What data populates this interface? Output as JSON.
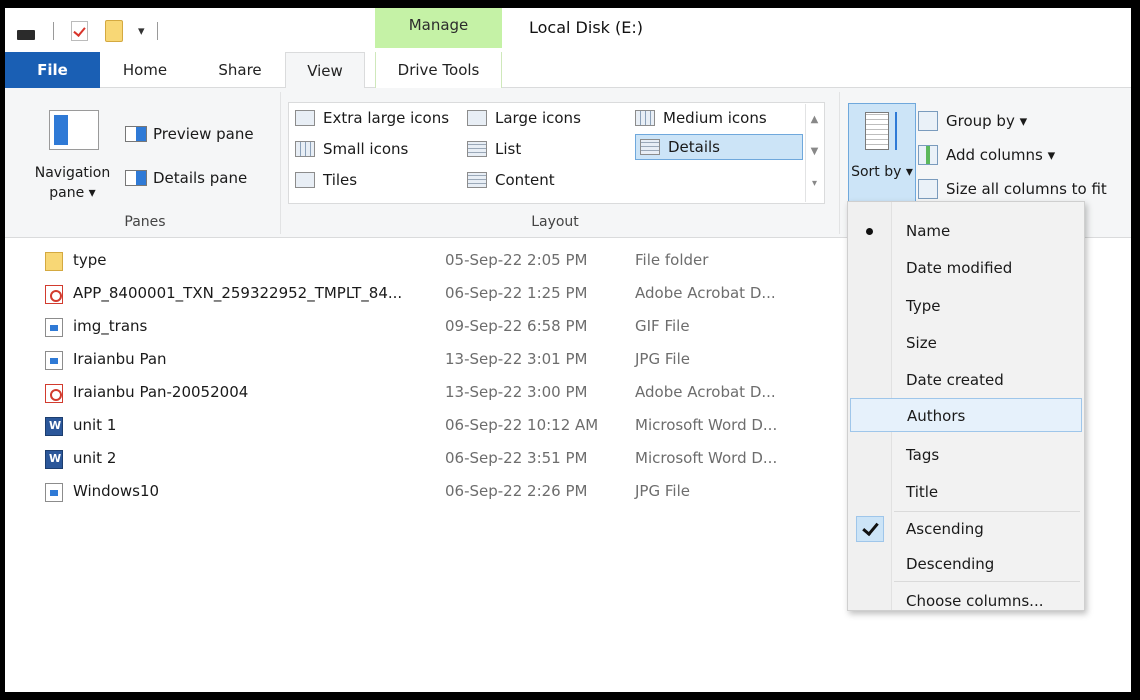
{
  "titlebar": {
    "manage_tab": "Manage",
    "window_title": "Local Disk (E:)",
    "qat_dropdown": "▾"
  },
  "tabs": {
    "file": "File",
    "home": "Home",
    "share": "Share",
    "view": "View",
    "drive_tools": "Drive Tools"
  },
  "ribbon": {
    "panes": {
      "navigation_pane": "Navigation pane ▾",
      "preview_pane": "Preview pane",
      "details_pane": "Details pane",
      "group_label": "Panes"
    },
    "layout": {
      "items": [
        "Extra large icons",
        "Large icons",
        "Medium icons",
        "Small icons",
        "List",
        "Details",
        "Tiles",
        "Content"
      ],
      "selected": "Details",
      "group_label": "Layout"
    },
    "current_view": {
      "sort_by": "Sort by ▾",
      "group_by": "Group by ▾",
      "add_columns": "Add columns ▾",
      "size_all_columns": "Size all columns to fit"
    },
    "colors": {
      "file_tab": "#1a5fb4",
      "manage_tab": "#c5f2a6",
      "selection": "#cce4f7"
    }
  },
  "files": [
    {
      "name": "type",
      "date": "05-Sep-22 2:05 PM",
      "type": "File folder",
      "icon": "folder-icon"
    },
    {
      "name": "APP_8400001_TXN_259322952_TMPLT_84...",
      "date": "06-Sep-22 1:25 PM",
      "type": "Adobe Acrobat D...",
      "icon": "pdf-icon"
    },
    {
      "name": "img_trans",
      "date": "09-Sep-22 6:58 PM",
      "type": "GIF File",
      "icon": "image-icon"
    },
    {
      "name": "Iraianbu Pan",
      "date": "13-Sep-22 3:01 PM",
      "type": "JPG File",
      "icon": "image-icon"
    },
    {
      "name": "Iraianbu Pan-20052004",
      "date": "13-Sep-22 3:00 PM",
      "type": "Adobe Acrobat D...",
      "icon": "pdf-icon"
    },
    {
      "name": "unit 1",
      "date": "06-Sep-22 10:12 AM",
      "type": "Microsoft Word D...",
      "icon": "word-icon"
    },
    {
      "name": "unit 2",
      "date": "06-Sep-22 3:51 PM",
      "type": "Microsoft Word D...",
      "icon": "word-icon"
    },
    {
      "name": "Windows10",
      "date": "06-Sep-22 2:26 PM",
      "type": "JPG File",
      "icon": "image-icon"
    }
  ],
  "sort_menu": {
    "items": [
      "Name",
      "Date modified",
      "Type",
      "Size",
      "Date created",
      "Authors",
      "Tags",
      "Title"
    ],
    "checked": "Name",
    "highlighted": "Authors",
    "order": [
      "Ascending",
      "Descending"
    ],
    "order_checked": "Ascending",
    "choose_columns": "Choose columns..."
  }
}
